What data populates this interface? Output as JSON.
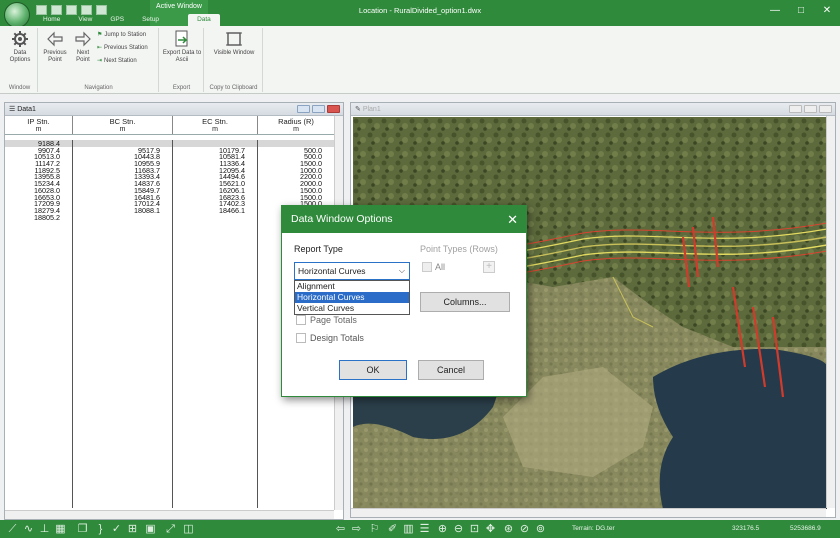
{
  "window": {
    "title": "Location - RuralDivided_option1.dwx",
    "contextual_tab_group": "Active Window",
    "controls": [
      "—",
      "□",
      "✕"
    ]
  },
  "ribbon": {
    "tabs": [
      "Home",
      "View",
      "GPS",
      "Setup",
      "Data"
    ],
    "active_tab": "Data",
    "groups": [
      {
        "label": "Window",
        "buttons": [
          {
            "label": "Data Options",
            "icon": "gear-icon"
          }
        ]
      },
      {
        "label": "Navigation",
        "buttons": [
          {
            "label": "Previous Point",
            "icon": "arrow-left-icon"
          },
          {
            "label": "Next Point",
            "icon": "arrow-right-icon"
          },
          {
            "label": "Jump to Station",
            "icon": "flag-icon"
          },
          {
            "label": "Previous Station",
            "icon": "station-back-icon"
          },
          {
            "label": "Next Station",
            "icon": "station-next-icon"
          }
        ]
      },
      {
        "label": "Export",
        "buttons": [
          {
            "label": "Export Data to Ascii",
            "icon": "export-icon"
          }
        ]
      },
      {
        "label": "Copy to Clipboard",
        "buttons": [
          {
            "label": "Visible Window",
            "icon": "window-frame-icon"
          }
        ]
      }
    ]
  },
  "data_panel": {
    "title": "Data1",
    "columns": [
      {
        "name": "IP Stn.",
        "unit": "m"
      },
      {
        "name": "BC Stn.",
        "unit": "m"
      },
      {
        "name": "EC Stn.",
        "unit": "m"
      },
      {
        "name": "Radius (R)",
        "unit": "m"
      }
    ],
    "rows": [
      [
        "9188.4",
        "",
        "",
        ""
      ],
      [
        "9907.4",
        "9517.9",
        "10179.7",
        "500.0"
      ],
      [
        "10513.0",
        "10443.8",
        "10581.4",
        "500.0"
      ],
      [
        "11147.2",
        "10955.9",
        "11336.4",
        "1500.0"
      ],
      [
        "11892.5",
        "11683.7",
        "12095.4",
        "1000.0"
      ],
      [
        "13955.8",
        "13393.4",
        "14494.6",
        "2200.0"
      ],
      [
        "15234.4",
        "14837.6",
        "15621.0",
        "2000.0"
      ],
      [
        "16028.0",
        "15849.7",
        "16206.1",
        "1500.0"
      ],
      [
        "16653.0",
        "16481.6",
        "16823.6",
        "1500.0"
      ],
      [
        "17209.9",
        "17012.4",
        "17402.3",
        "1500.0"
      ],
      [
        "18279.4",
        "18088.1",
        "18466.1",
        "2000.0"
      ],
      [
        "18805.2",
        "",
        "",
        ""
      ]
    ]
  },
  "plan_panel": {
    "title": "Plan1"
  },
  "dialog": {
    "title": "Data Window Options",
    "report_type_label": "Report Type",
    "report_type_value": "Horizontal Curves",
    "report_type_options": [
      "Alignment",
      "Horizontal Curves",
      "Vertical Curves"
    ],
    "point_types_label": "Point Types (Rows)",
    "all_label": "All",
    "plus_label": "+",
    "columns_button": "Columns...",
    "page_totals_label": "Page Totals",
    "design_totals_label": "Design Totals",
    "ok_button": "OK",
    "cancel_button": "Cancel"
  },
  "status_bar": {
    "terrain": "Terrain: DG.ter",
    "coord_x": "323176.5",
    "coord_y": "5253686.9"
  },
  "colors": {
    "accent": "#2f8a3b",
    "selection": "#2a6cc7"
  }
}
